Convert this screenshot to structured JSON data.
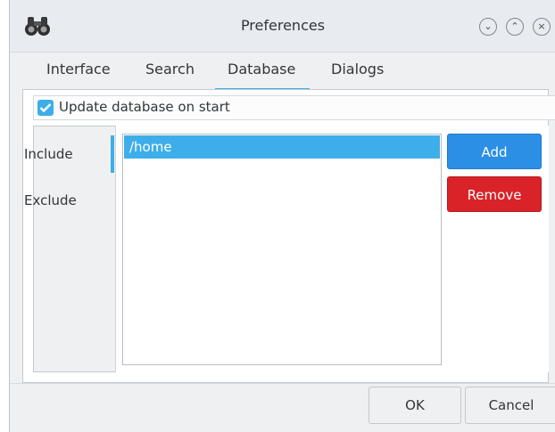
{
  "window": {
    "title": "Preferences",
    "app_icon": "binoculars-icon",
    "controls": {
      "minimize": "⌄",
      "maximize": "⌃",
      "close": "×"
    }
  },
  "tabs": [
    {
      "label": "Interface",
      "active": false
    },
    {
      "label": "Search",
      "active": false
    },
    {
      "label": "Database",
      "active": true
    },
    {
      "label": "Dialogs",
      "active": false
    }
  ],
  "database": {
    "update_on_start_label": "Update database on start",
    "update_on_start_checked": true,
    "side_tabs": [
      {
        "label": "Include",
        "active": true
      },
      {
        "label": "Exclude",
        "active": false
      }
    ],
    "paths": [
      "/home"
    ],
    "add_label": "Add",
    "remove_label": "Remove"
  },
  "footer": {
    "ok_label": "OK",
    "cancel_label": "Cancel"
  },
  "colors": {
    "accent": "#3daee9",
    "add_button": "#2b8fe6",
    "remove_button": "#da2328",
    "window_bg": "#eff0f1"
  }
}
